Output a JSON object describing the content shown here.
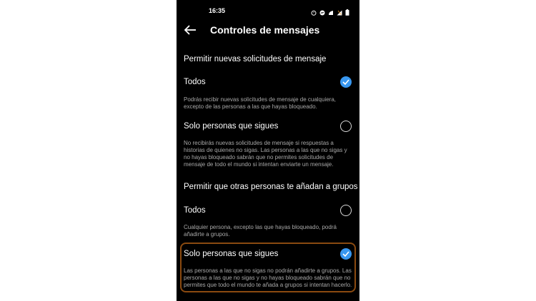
{
  "status_bar": {
    "time": "16:35",
    "icons": [
      "alarm-icon",
      "messenger-icon",
      "cast-icon",
      "signal-icon",
      "battery-icon"
    ]
  },
  "app_bar": {
    "back_icon": "arrow-left-icon",
    "title": "Controles de mensajes"
  },
  "sections": [
    {
      "header": "Permitir nuevas solicitudes de mensaje",
      "options": [
        {
          "label": "Todos",
          "description": "Podrás recibir nuevas solicitudes de mensaje de cualquiera, excepto de las personas a las que hayas bloqueado.",
          "selected": true
        },
        {
          "label": "Solo personas que sigues",
          "description": "No recibirás nuevas solicitudes de mensaje si respuestas a historias de quienes no sigas. Las personas a las que no sigas y no hayas bloqueado sabrán que no permites solicitudes de mensaje de todo el mundo si intentan enviarte un mensaje.",
          "selected": false
        }
      ]
    },
    {
      "header": "Permitir que otras personas te añadan a grupos",
      "options": [
        {
          "label": "Todos",
          "description": "Cualquier persona, excepto las que hayas bloqueado, podrá añadirte a grupos.",
          "selected": false
        },
        {
          "label": "Solo personas que sigues",
          "description": "Las personas a las que no sigas no podrán añadirte a grupos. Las personas a las que no sigas y no hayas bloqueado sabrán que no permites que todo el mundo te añada a grupos si intentan hacerlo.",
          "selected": true
        }
      ]
    }
  ],
  "colors": {
    "background": "#000000",
    "accent": "#3897f0",
    "secondary_text": "#a8a8a8",
    "highlight_border": "#8a4a10"
  }
}
